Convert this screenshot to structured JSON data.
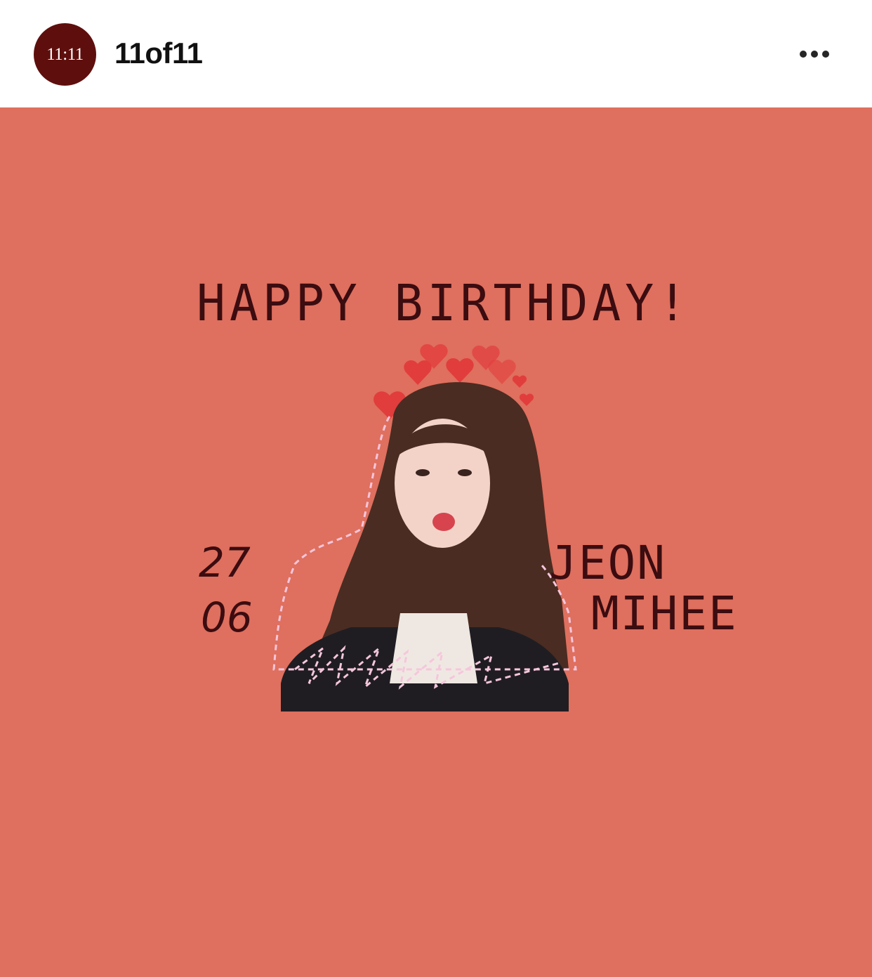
{
  "header": {
    "avatar_text": "11:11",
    "username": "11of11",
    "more_icon": "more-horizontal-icon"
  },
  "post": {
    "background_color": "#df6f5e",
    "title": "HAPPY BIRTHDAY!",
    "date_day": "27",
    "date_month": "06",
    "name_first": "JEON",
    "name_last": "MIHEE",
    "photo_description_icon": "person-photo"
  }
}
